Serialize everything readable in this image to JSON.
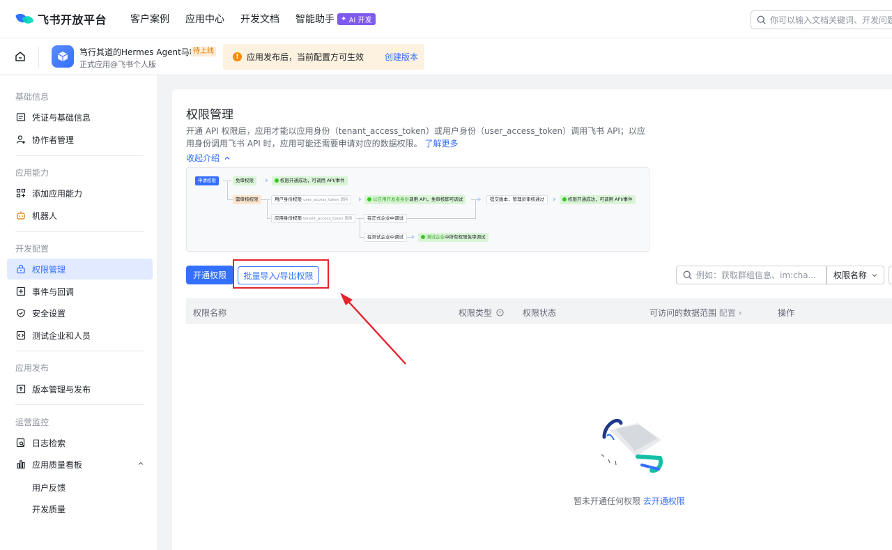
{
  "topnav": {
    "brand": "飞书开放平台",
    "links": [
      "客户案例",
      "应用中心",
      "开发文档",
      "智能助手"
    ],
    "ai_badge": "AI 开发",
    "search_placeholder": "你可以输入文档关键词、开发问题"
  },
  "appbar": {
    "app_name": "笃行其道的Hermes Agent马喽",
    "app_status": "待上线",
    "app_sub": "正式应用@飞书个人版",
    "notice_text": "应用发布后，当前配置方可生效",
    "notice_link": "创建版本"
  },
  "sidebar": {
    "groups": {
      "basic": "基础信息",
      "capability": "应用能力",
      "dev": "开发配置",
      "publish": "应用发布",
      "ops": "运营监控"
    },
    "items": {
      "credentials": "凭证与基础信息",
      "collaborators": "协作者管理",
      "add_capability": "添加应用能力",
      "bot": "机器人",
      "permissions": "权限管理",
      "events": "事件与回调",
      "security": "安全设置",
      "test_enterprise": "测试企业和人员",
      "versions": "版本管理与发布",
      "logs": "日志检索",
      "quality": "应用质量看板",
      "feedback": "用户反馈",
      "dev_quality": "开发质量"
    }
  },
  "main": {
    "title": "权限管理",
    "desc_text": "开通 API 权限后，应用才能以应用身份（tenant_access_token）或用户身份（user_access_token）调用飞书 API；以应用身份调用飞书 API 时，应用可能还需要申请对应的数据权限。",
    "desc_link": "了解更多",
    "collapse": "收起介绍",
    "flow": {
      "apply": "申请权限",
      "no_review": "免审权限",
      "success1": "权限开通成功，可调用 API/事件",
      "need_review": "需审核权限",
      "user_identity": "用户身份权限",
      "user_token": "user_access_token 调用",
      "dev_identity_a": "以应用开发者身份",
      "dev_identity_b": "调用 API，免审核即可调试",
      "submit": "提交版本，管理员审核通过",
      "success2": "权限开通成功，可调用 API/事件",
      "app_identity": "应用身份权限",
      "tenant_token": "tenant_access_token 调用",
      "formal": "在正式企业中调试",
      "test": "在测试企业中调试",
      "test_free_a": "测试企业",
      "test_free_b": "中所有权限免审调试"
    },
    "btn_open": "开通权限",
    "btn_batch": "批量导入/导出权限",
    "search_placeholder": "例如：获取群组信息、im:cha...",
    "filter": "权限名称",
    "table_headers": {
      "name": "权限名称",
      "type": "权限类型",
      "status": "权限状态",
      "scope": "可访问的数据范围",
      "scope_config": "配置",
      "action": "操作"
    },
    "empty_text": "暂未开通任何权限",
    "empty_link": "去开通权限"
  },
  "colors": {
    "primary": "#3370ff",
    "highlight": "#e5232b",
    "warning_bg": "#fdf1df"
  }
}
